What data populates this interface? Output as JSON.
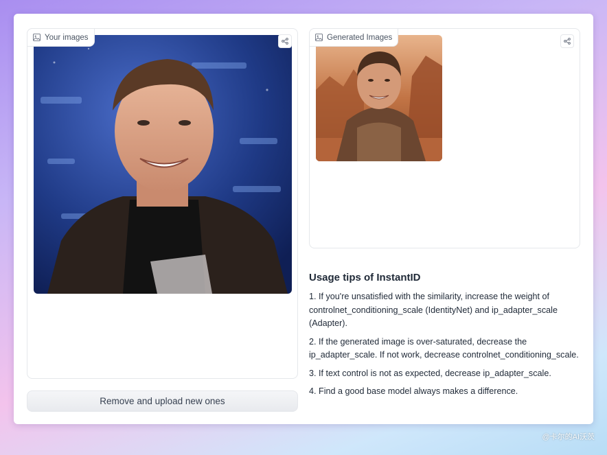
{
  "input_panel": {
    "label": "Your images",
    "label_icon": "image-icon",
    "share_icon": "share-icon"
  },
  "output_panel": {
    "label": "Generated Images",
    "label_icon": "image-icon",
    "share_icon": "share-icon"
  },
  "upload_button": {
    "label": "Remove and upload new ones"
  },
  "tips": {
    "title": "Usage tips of InstantID",
    "items": [
      "1. If you're unsatisfied with the similarity, increase the weight of controlnet_conditioning_scale (IdentityNet) and ip_adapter_scale (Adapter).",
      "2. If the generated image is over-saturated, decrease the ip_adapter_scale. If not work, decrease controlnet_conditioning_scale.",
      "3. If text control is not as expected, decrease ip_adapter_scale.",
      "4. Find a good base model always makes a difference."
    ]
  },
  "watermark": "@卡尔的AI沃茨",
  "colors": {
    "background_start": "#a98ef0",
    "card": "#ffffff",
    "border": "#e5e7eb",
    "button": "#e8eaee"
  }
}
